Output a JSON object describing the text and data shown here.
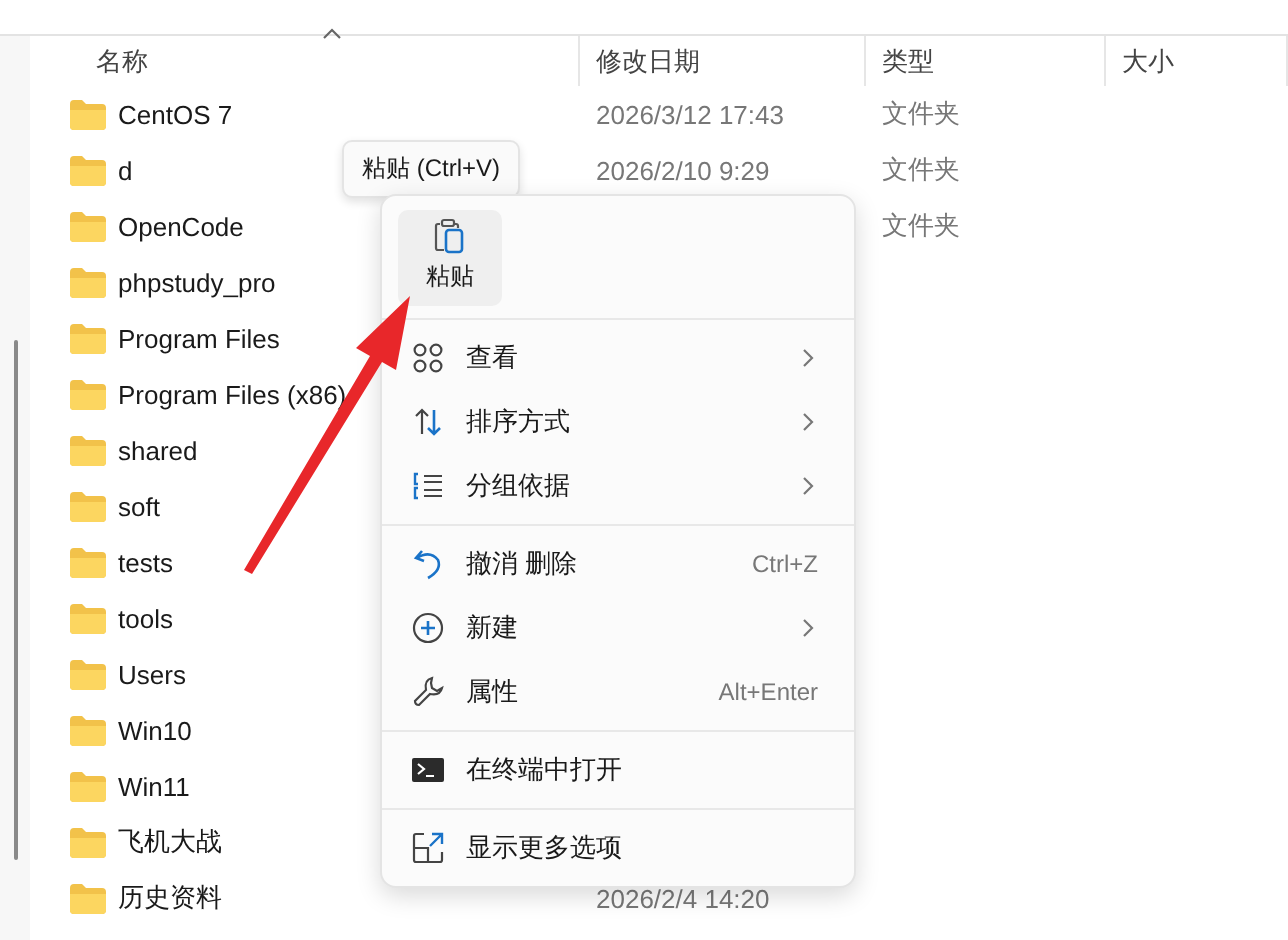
{
  "columns": [
    {
      "label": "名称",
      "sorted": true
    },
    {
      "label": "修改日期"
    },
    {
      "label": "类型"
    },
    {
      "label": "大小"
    }
  ],
  "files": [
    {
      "name": "CentOS 7",
      "modified": "2026/3/12 17:43",
      "type": "文件夹"
    },
    {
      "name": "d",
      "modified": "2026/2/10 9:29",
      "type": "文件夹"
    },
    {
      "name": "OpenCode",
      "type": "文件夹"
    },
    {
      "name": "phpstudy_pro"
    },
    {
      "name": "Program Files"
    },
    {
      "name": "Program Files (x86)"
    },
    {
      "name": "shared"
    },
    {
      "name": "soft"
    },
    {
      "name": "tests"
    },
    {
      "name": "tools"
    },
    {
      "name": "Users"
    },
    {
      "name": "Win10"
    },
    {
      "name": "Win11"
    },
    {
      "name": "飞机大战"
    },
    {
      "name": "历史资料",
      "modified": "2026/2/4 14:20"
    }
  ],
  "tooltip": "粘贴 (Ctrl+V)",
  "context_menu": {
    "top_actions": [
      {
        "label": "粘贴"
      }
    ],
    "groups": [
      {
        "items": [
          {
            "label": "查看",
            "submenu": true
          },
          {
            "label": "排序方式",
            "submenu": true
          },
          {
            "label": "分组依据",
            "submenu": true
          }
        ]
      },
      {
        "items": [
          {
            "label": "撤消 删除",
            "shortcut": "Ctrl+Z",
            "submenu": false
          },
          {
            "label": "新建",
            "submenu": true
          },
          {
            "label": "属性",
            "shortcut": "Alt+Enter",
            "submenu": false
          }
        ]
      },
      {
        "items": [
          {
            "label": "在终端中打开",
            "submenu": false
          }
        ]
      },
      {
        "items": [
          {
            "label": "显示更多选项",
            "submenu": false
          }
        ]
      }
    ]
  }
}
